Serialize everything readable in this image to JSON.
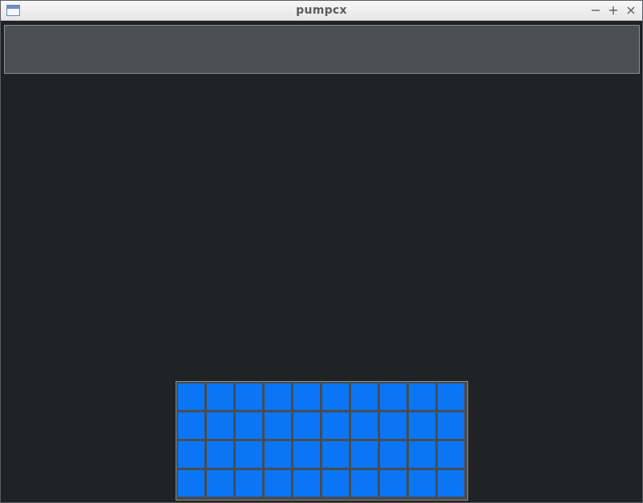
{
  "window": {
    "title": "pumpcx",
    "controls": {
      "minimize": "−",
      "maximize": "+",
      "close": "×"
    }
  },
  "grid": {
    "rows": 4,
    "cols": 10,
    "cell_color": "#0a76f5"
  },
  "colors": {
    "background": "#202226",
    "top_panel": "#4c4f54"
  }
}
